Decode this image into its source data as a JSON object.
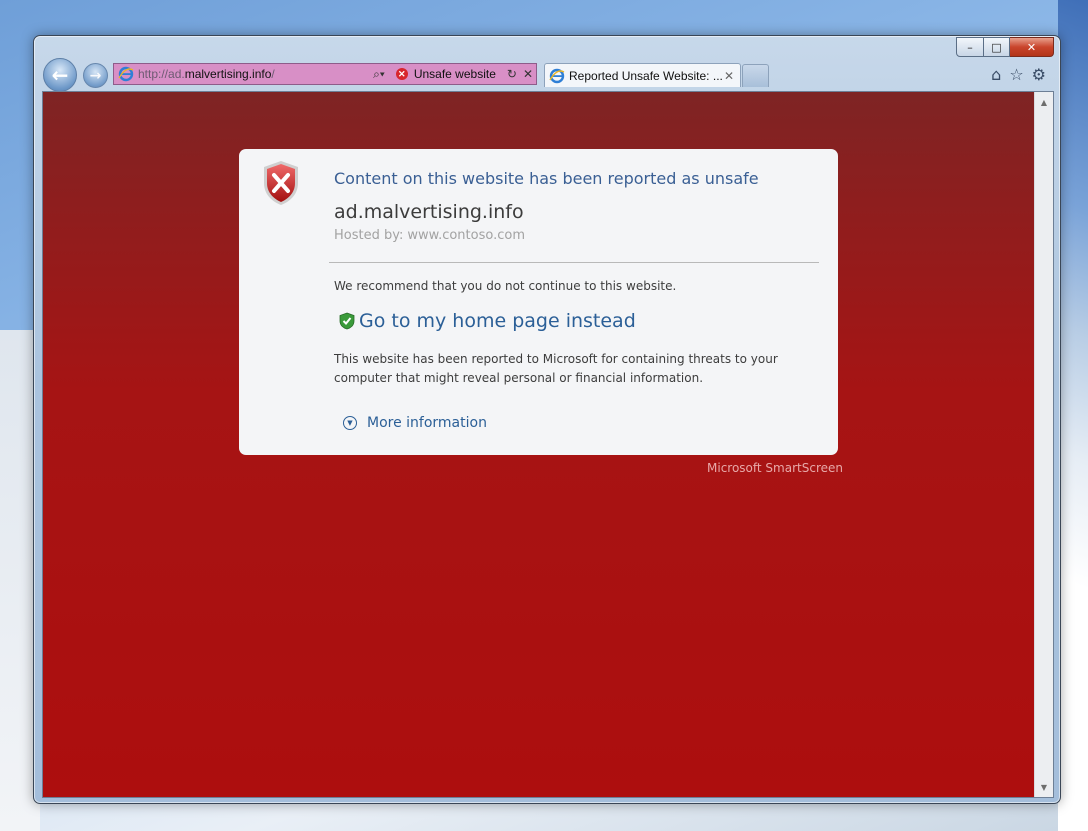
{
  "browser": {
    "address": {
      "url_prefix": "http://ad.",
      "url_host": "malvertising.info",
      "url_suffix": "/",
      "security_status": "Unsafe website"
    },
    "tabs": [
      {
        "label": "Reported Unsafe Website: ..."
      }
    ],
    "caption": {
      "minimize": "–",
      "maximize": "□",
      "close": "✕"
    }
  },
  "warning": {
    "title": "Content on this website has been reported as unsafe",
    "domain": "ad.malvertising.info",
    "hosted_label": "Hosted by:",
    "hosted_value": "www.contoso.com",
    "recommendation": "We recommend that you do not continue to this website.",
    "home_link": "Go to my home page instead",
    "reported_text": "This website has been reported to Microsoft for containing threats to your computer that might reveal personal or financial information.",
    "more_info": "More information",
    "footer": "Microsoft SmartScreen"
  },
  "colors": {
    "page_top": "#7e2424",
    "page_bottom": "#ad0e0e",
    "address_bar": "#d88fc6",
    "link": "#2b5f97",
    "title": "#3a5f94"
  },
  "icons": [
    "back-icon",
    "forward-icon",
    "ie-logo-icon",
    "search-icon",
    "unsafe-icon",
    "refresh-icon",
    "close-icon",
    "home-icon",
    "favorites-icon",
    "tools-icon",
    "shield-error-icon",
    "shield-check-icon",
    "chevron-down-icon"
  ]
}
